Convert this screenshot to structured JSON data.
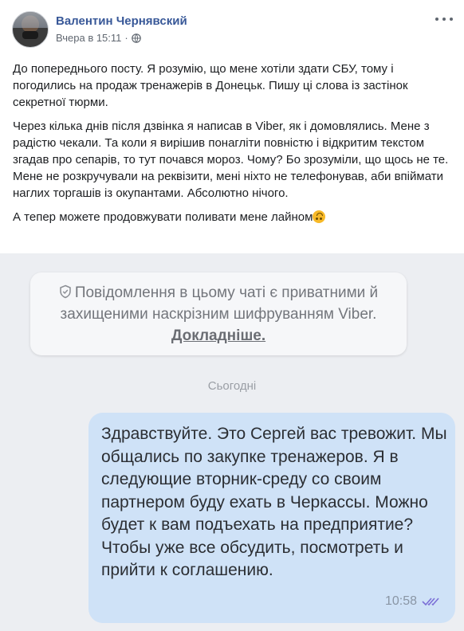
{
  "post": {
    "author": "Валентин Чернявский",
    "timestamp": "Вчера в 15:11",
    "privacy_icon": "globe-icon",
    "paragraphs": [
      "До попереднього посту. Я розумію, що мене хотіли здати СБУ, тому і погодились на продаж тренажерів в Донецьк. Пишу ці слова із застінок секретної тюрми.",
      "Через кілька днів після дзвінка я написав в Viber, як і домовлялись. Мене з радістю чекали. Та коли я вирішив понагліти повністю і відкритим текстом згадав про сепарів, то тут почався мороз. Чому? Бо зрозуміли, що щось не те. Мене не розкручували на реквізити, мені ніхто не телефонував, аби впіймати наглих торгашів із окупантами. Абсолютно нічого."
    ],
    "last_line": "А тепер можете продовжувати поливати мене лайном",
    "emoji": "upside-down-face"
  },
  "viber": {
    "encryption_notice": "Повідомлення в цьому чаті є приватними й захищеними наскрізним шифруванням Viber.",
    "encryption_link": "Докладніше.",
    "date_separator": "Сьогодні",
    "message": {
      "text": "Здравствуйте. Это Сергей вас тревожит. Мы общались по закупке тренажеров. Я в следующие вторник-среду со своим партнером буду ехать в Черкассы. Можно будет к вам подъехать на предприятие? Чтобы уже все обсудить, посмотреть и прийти к соглашению.",
      "time": "10:58",
      "status_icon": "double-check-icon"
    }
  },
  "colors": {
    "author": "#385898",
    "message_bubble": "#cfe2f7",
    "chat_background": "#eceef2"
  }
}
